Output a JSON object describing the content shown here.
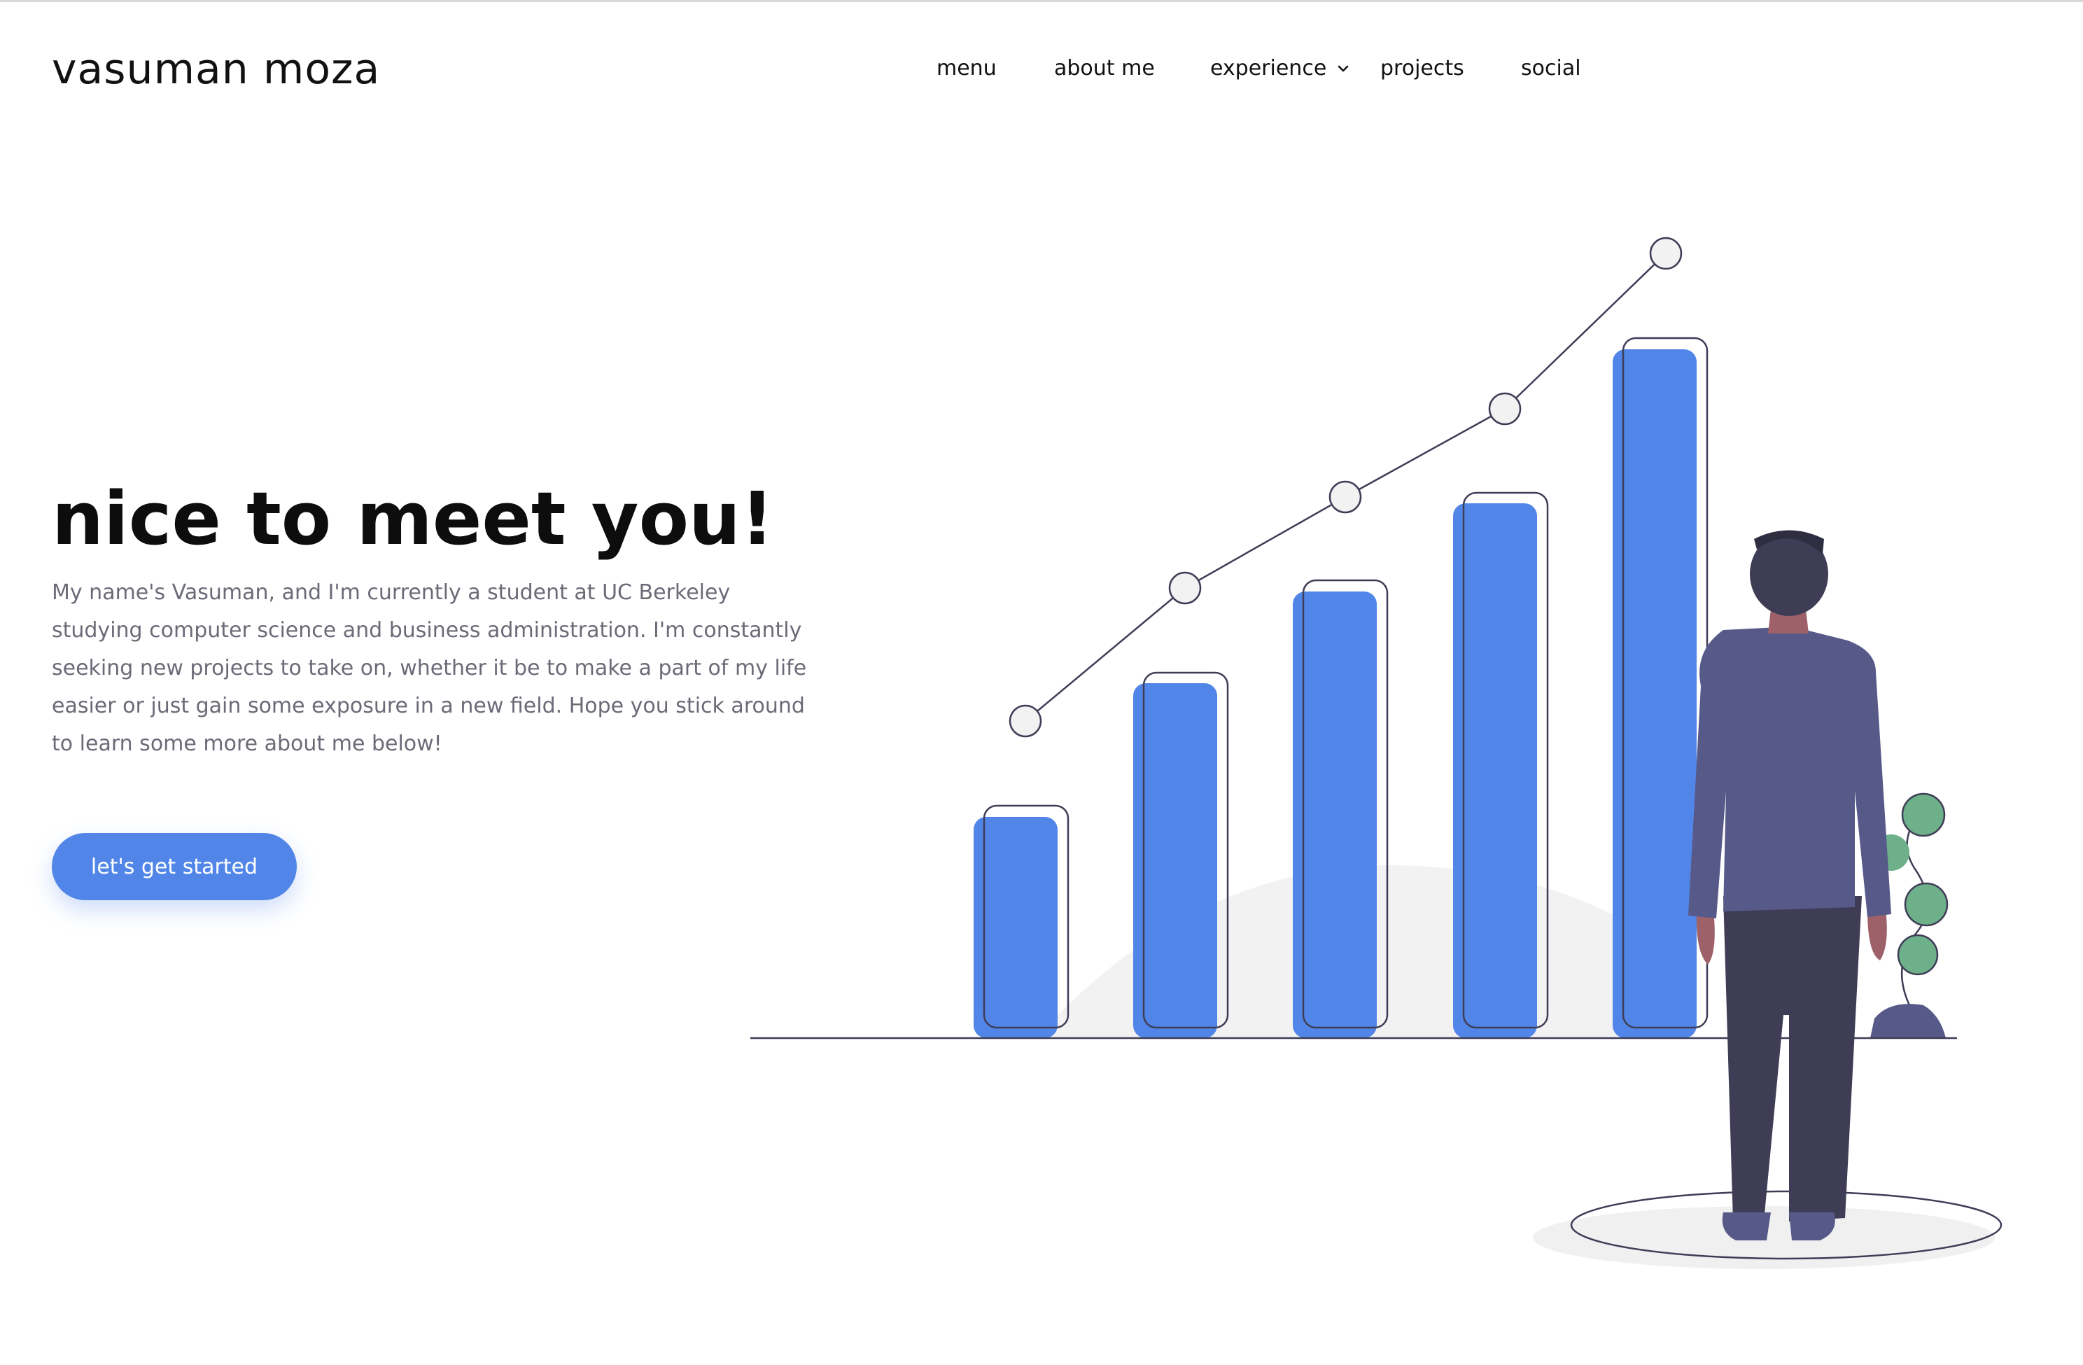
{
  "brand": {
    "name": "vasuman moza"
  },
  "nav": {
    "items": [
      {
        "label": "menu"
      },
      {
        "label": "about me"
      },
      {
        "label": "experience",
        "has_dropdown": true
      },
      {
        "label": "projects"
      },
      {
        "label": "social"
      }
    ]
  },
  "hero": {
    "title": "nice to meet you!",
    "description": "My name's Vasuman, and I'm currently a student at UC Berkeley studying computer science and business administration. I'm constantly seeking new projects to take on, whether it be to make a part of my life easier or just gain some exposure in a new field. Hope you stick around to learn some more about me below!",
    "cta_label": "let's get started"
  },
  "colors": {
    "accent": "#5186e8",
    "text_dark": "#111111",
    "text_muted": "#6b6b78",
    "suit": "#575a89",
    "hair": "#3f3d56",
    "leaf": "#6db08a"
  },
  "illustration": {
    "description_icon": "growth-chart-person-illustration",
    "bar_levels": [
      0.3,
      0.52,
      0.64,
      0.77,
      1.0
    ]
  }
}
